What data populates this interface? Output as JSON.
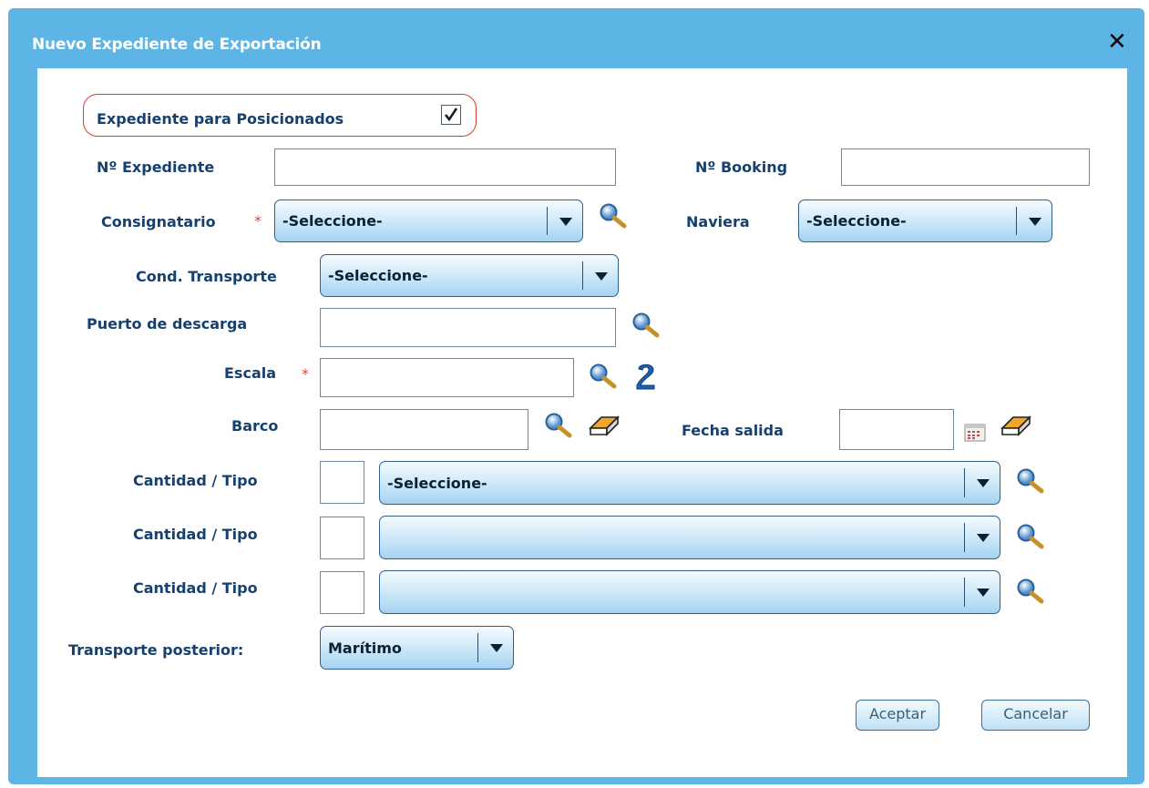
{
  "dialog": {
    "title": "Nuevo Expediente de Exportación",
    "close_icon": "close-icon"
  },
  "form": {
    "posicionados_label": "Expediente para Posicionados",
    "posicionados_checked": true,
    "expediente_label": "Nº Expediente",
    "expediente_value": "",
    "booking_label": "Nº Booking",
    "booking_value": "",
    "consignatario_label": "Consignatario",
    "consignatario_value": "-Seleccione-",
    "naviera_label": "Naviera",
    "naviera_value": "-Seleccione-",
    "cond_transporte_label": "Cond. Transporte",
    "cond_transporte_value": "-Seleccione-",
    "puerto_label": "Puerto de descarga",
    "puerto_value": "",
    "escala_label": "Escala",
    "escala_value": "",
    "barco_label": "Barco",
    "barco_value": "",
    "fecha_salida_label": "Fecha salida",
    "fecha_salida_value": "",
    "required_marker": "*",
    "cantidad_rows": [
      {
        "label": "Cantidad / Tipo",
        "qty": "",
        "tipo": "-Seleccione-"
      },
      {
        "label": "Cantidad / Tipo",
        "qty": "",
        "tipo": ""
      },
      {
        "label": "Cantidad / Tipo",
        "qty": "",
        "tipo": ""
      }
    ],
    "transporte_posterior_label": "Transporte posterior:",
    "transporte_posterior_value": "Marítimo"
  },
  "buttons": {
    "accept": "Aceptar",
    "cancel": "Cancelar"
  },
  "colors": {
    "header": "#5cb5e4",
    "label": "#17406e",
    "required": "#e4423b",
    "highlight": "#dc3a2e"
  }
}
